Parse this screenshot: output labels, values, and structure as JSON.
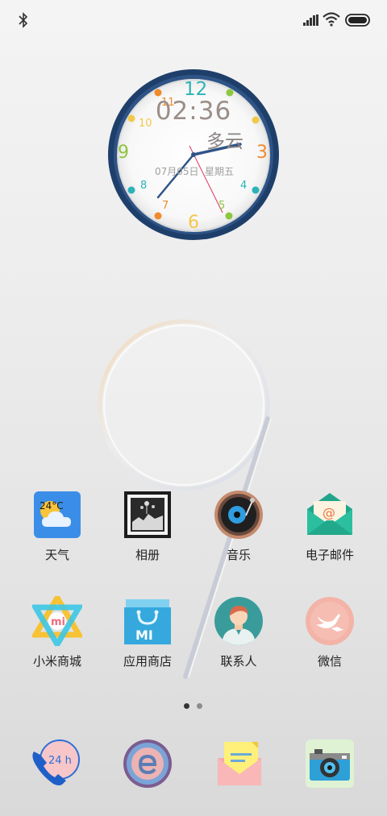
{
  "status_bar": {
    "left_icons": [
      "bluetooth-icon"
    ],
    "right_icons": [
      "signal-icon",
      "wifi-icon",
      "battery-icon"
    ]
  },
  "clock_widget": {
    "time": "02:36",
    "weather": "多云",
    "date": "07月05日",
    "weekday": "星期五",
    "dial_numbers": [
      "12",
      "11",
      "10",
      "9",
      "8",
      "7",
      "6",
      "5",
      "4",
      "3"
    ]
  },
  "apps_row1": [
    {
      "label": "天气",
      "icon": "weather-icon",
      "badge_text": "24°C"
    },
    {
      "label": "相册",
      "icon": "gallery-icon"
    },
    {
      "label": "音乐",
      "icon": "music-icon"
    },
    {
      "label": "电子邮件",
      "icon": "email-icon"
    }
  ],
  "apps_row2": [
    {
      "label": "小米商城",
      "icon": "mi-store-icon",
      "badge_text": "mi"
    },
    {
      "label": "应用商店",
      "icon": "app-store-icon",
      "badge_text": "MI"
    },
    {
      "label": "联系人",
      "icon": "contacts-icon"
    },
    {
      "label": "微信",
      "icon": "wechat-icon"
    }
  ],
  "page_indicator": {
    "pages": 2,
    "current": 1
  },
  "dock": [
    {
      "icon": "phone-icon",
      "badge_text": "24 h"
    },
    {
      "icon": "browser-icon"
    },
    {
      "icon": "notes-icon"
    },
    {
      "icon": "camera-icon"
    }
  ],
  "colors": {
    "clock_ring": "#1f3f6b",
    "accent_teal": "#2bb3b8",
    "accent_orange": "#f08a2c",
    "accent_yellow": "#f2c84b",
    "accent_green": "#8dc63f"
  }
}
